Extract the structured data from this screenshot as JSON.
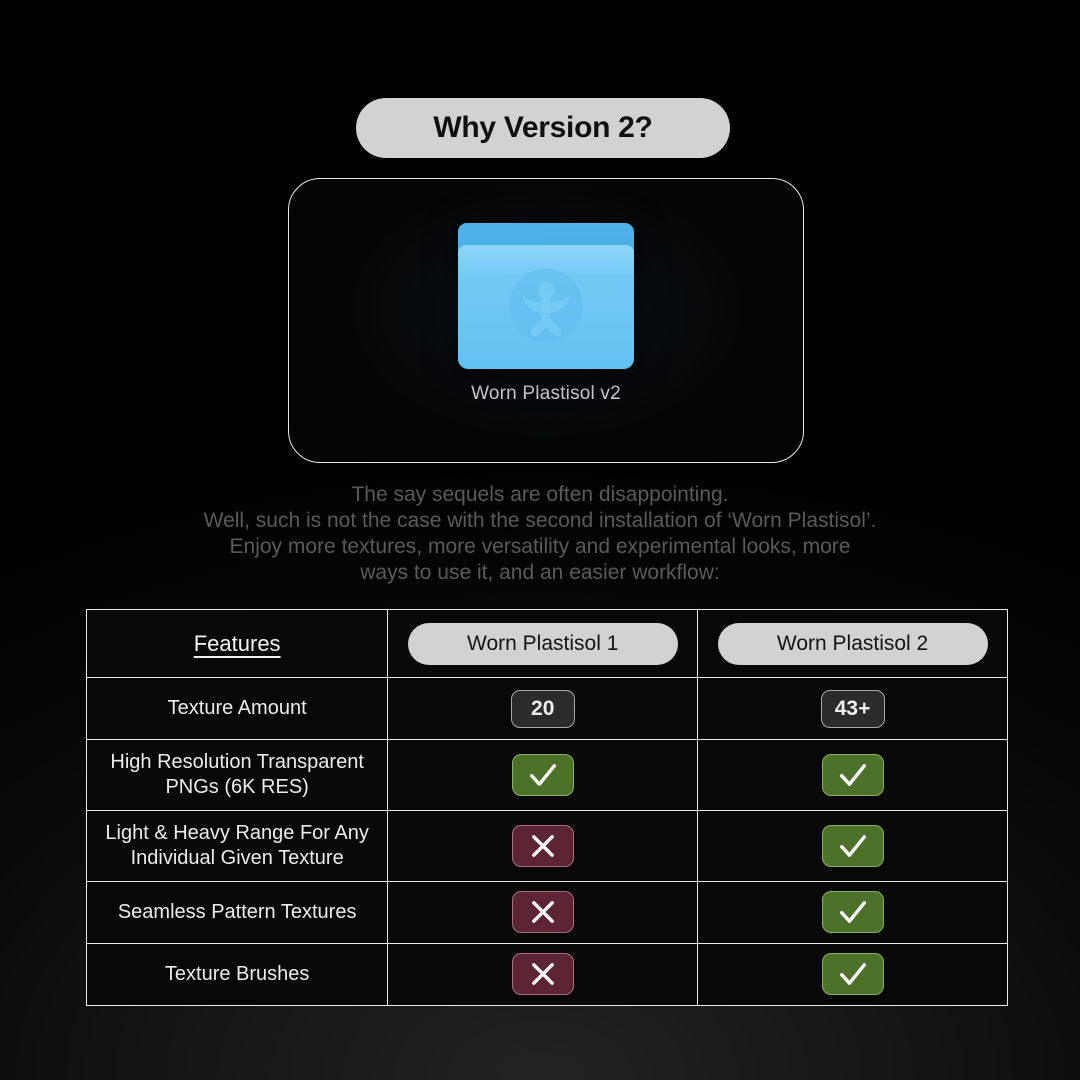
{
  "header": {
    "title": "Why Version 2?"
  },
  "folder_card": {
    "icon_name": "blue-folder-icon",
    "emblem_name": "figure-emblem-icon",
    "label": "Worn Plastisol v2"
  },
  "blurb": {
    "lines": [
      "The say sequels are often disappointing.",
      "Well, such is not the case with the second installation of ‘Worn Plastisol’.",
      "Enjoy more textures, more versatility and experimental looks, more",
      "ways to use it, and an easier workflow:"
    ]
  },
  "table": {
    "columns": [
      {
        "label": "Features",
        "style": "underlined-text"
      },
      {
        "label": "Worn Plastisol 1",
        "style": "pill"
      },
      {
        "label": "Worn Plastisol 2",
        "style": "pill"
      }
    ],
    "rows": [
      {
        "feature": "Texture Amount",
        "v1": {
          "type": "number",
          "value": "20"
        },
        "v2": {
          "type": "number",
          "value": "43+"
        }
      },
      {
        "feature": "High Resolution Transparent PNGs (6K RES)",
        "v1": {
          "type": "check",
          "value": "✓"
        },
        "v2": {
          "type": "check",
          "value": "✓"
        }
      },
      {
        "feature": "Light & Heavy Range For Any Individual Given Texture",
        "v1": {
          "type": "cross",
          "value": "✕"
        },
        "v2": {
          "type": "check",
          "value": "✓"
        }
      },
      {
        "feature": "Seamless Pattern Textures",
        "v1": {
          "type": "cross",
          "value": "✕"
        },
        "v2": {
          "type": "check",
          "value": "✓"
        }
      },
      {
        "feature": "Texture Brushes",
        "v1": {
          "type": "cross",
          "value": "✕"
        },
        "v2": {
          "type": "check",
          "value": "✓"
        }
      }
    ]
  },
  "colors": {
    "background": "#000000",
    "pill": "#d2d2d2",
    "pill_text": "#141414",
    "border": "#e9e9e9",
    "text": "#ececec",
    "blurb_text": "#5a5a5a",
    "folder_front": "#73c9f4",
    "folder_back": "#3f9fd8",
    "badge_yes": "#4c7229",
    "badge_no": "#5d2434",
    "badge_num": "#2b2b2b"
  }
}
